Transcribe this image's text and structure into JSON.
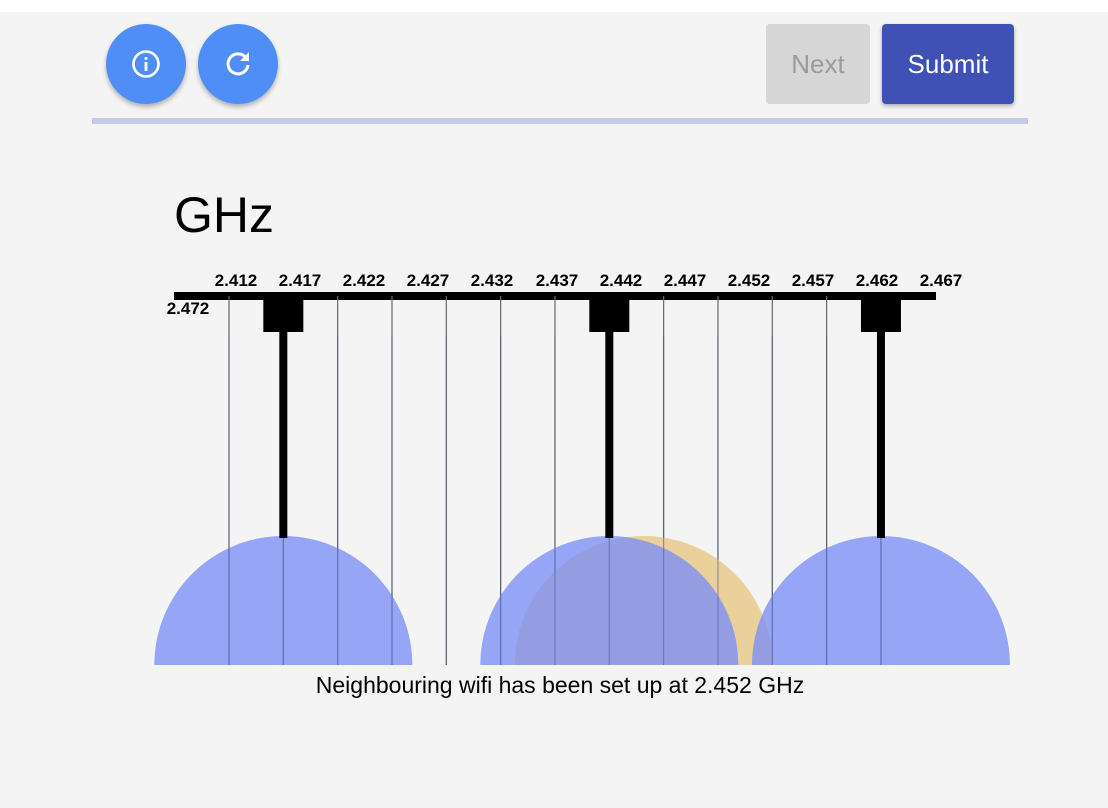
{
  "toolbar": {
    "info_icon": "info-icon",
    "refresh_icon": "refresh-icon",
    "next_label": "Next",
    "submit_label": "Submit",
    "next_enabled": false,
    "colors": {
      "round_button": "#4f8ef7",
      "submit": "#3f51b5",
      "next_disabled_bg": "#d6d6d6",
      "next_disabled_text": "#9a9a9a",
      "divider": "#c5cae9"
    }
  },
  "frequency_panel": {
    "unit_label": "GHz",
    "frequencies": [
      "2.412",
      "2.417",
      "2.422",
      "2.427",
      "2.432",
      "2.437",
      "2.442",
      "2.447",
      "2.452",
      "2.457",
      "2.462",
      "2.467",
      "2.472"
    ],
    "user_channels": [
      "2.417",
      "2.447",
      "2.472"
    ],
    "neighbour_channel": "2.452",
    "colors": {
      "user_signal": "#7b8ef5",
      "neighbour_signal": "#e8c98a"
    }
  },
  "status": {
    "message": "Neighbouring wifi has been set up at 2.452 GHz"
  }
}
